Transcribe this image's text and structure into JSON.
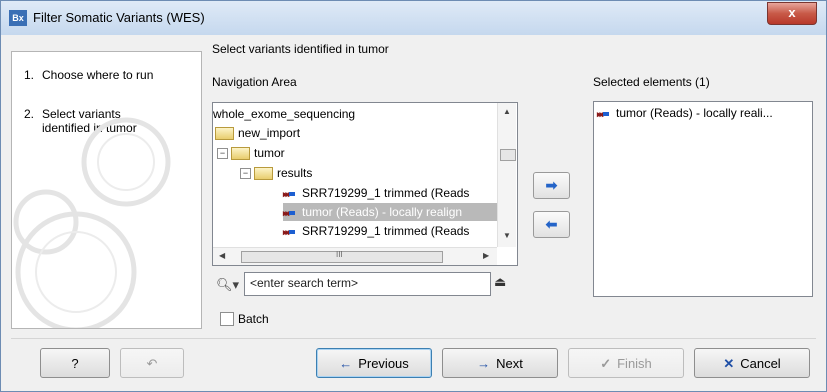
{
  "window": {
    "title": "Filter Somatic Variants (WES)",
    "app_icon_text": "Bx",
    "close_glyph": "x"
  },
  "steps": [
    {
      "num": "1.",
      "label": "Choose where to run"
    },
    {
      "num": "2.",
      "label_line1": "Select variants",
      "label_line2": "identified in tumor"
    }
  ],
  "main": {
    "heading": "Select variants identified in tumor",
    "navigation_label": "Navigation Area",
    "selected_label": "Selected elements (1)",
    "tree": [
      {
        "label": "whole_exome_sequencing"
      },
      {
        "label": "new_import"
      },
      {
        "label": "tumor"
      },
      {
        "label": "results"
      },
      {
        "label": "SRR719299_1 trimmed (Reads"
      },
      {
        "label": "tumor (Reads) - locally realign"
      },
      {
        "label": "SRR719299_1 trimmed (Reads"
      }
    ],
    "hscroll_grip": "III",
    "search_placeholder": "<enter search term>",
    "batch_label": "Batch",
    "selected_items": [
      {
        "label": "tumor (Reads) - locally reali..."
      }
    ]
  },
  "buttons": {
    "help": "?",
    "previous": "Previous",
    "next": "Next",
    "finish": "Finish",
    "cancel": "Cancel"
  },
  "colors": {
    "accent": "#1f4fa6",
    "selection": "#b9b9b9",
    "titlebar": "#c5d8ee",
    "close": "#c85a48"
  },
  "icons": [
    "app-icon",
    "close-icon",
    "folder-icon",
    "reads-icon",
    "search-icon",
    "eject-icon",
    "add-arrow-icon",
    "remove-arrow-icon",
    "help-icon",
    "reset-icon",
    "left-arrow-icon",
    "right-arrow-icon",
    "check-icon",
    "x-icon"
  ]
}
